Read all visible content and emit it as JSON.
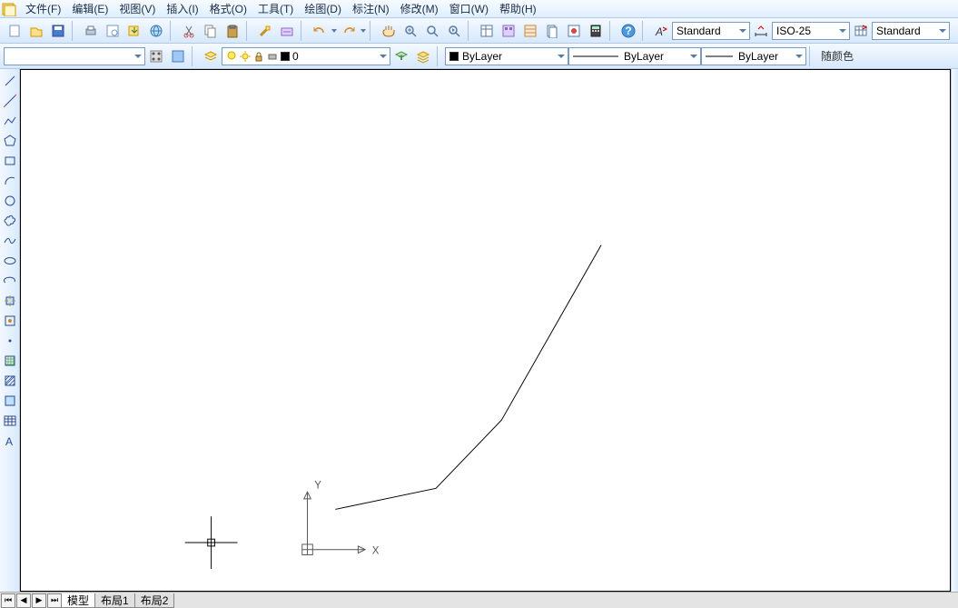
{
  "menu": {
    "items": [
      "文件(F)",
      "编辑(E)",
      "视图(V)",
      "插入(I)",
      "格式(O)",
      "工具(T)",
      "绘图(D)",
      "标注(N)",
      "修改(M)",
      "窗口(W)",
      "帮助(H)"
    ]
  },
  "styles": {
    "text_style": "Standard",
    "dim_style": "ISO-25",
    "table_style": "Standard"
  },
  "layer": {
    "current": "0",
    "color_prop": "ByLayer",
    "linetype_prop": "ByLayer",
    "lineweight_prop": "ByLayer"
  },
  "right_label": "随颜色",
  "ucs": {
    "x": "X",
    "y": "Y"
  },
  "tabs": {
    "model": "模型",
    "layout1": "布局1",
    "layout2": "布局2"
  }
}
